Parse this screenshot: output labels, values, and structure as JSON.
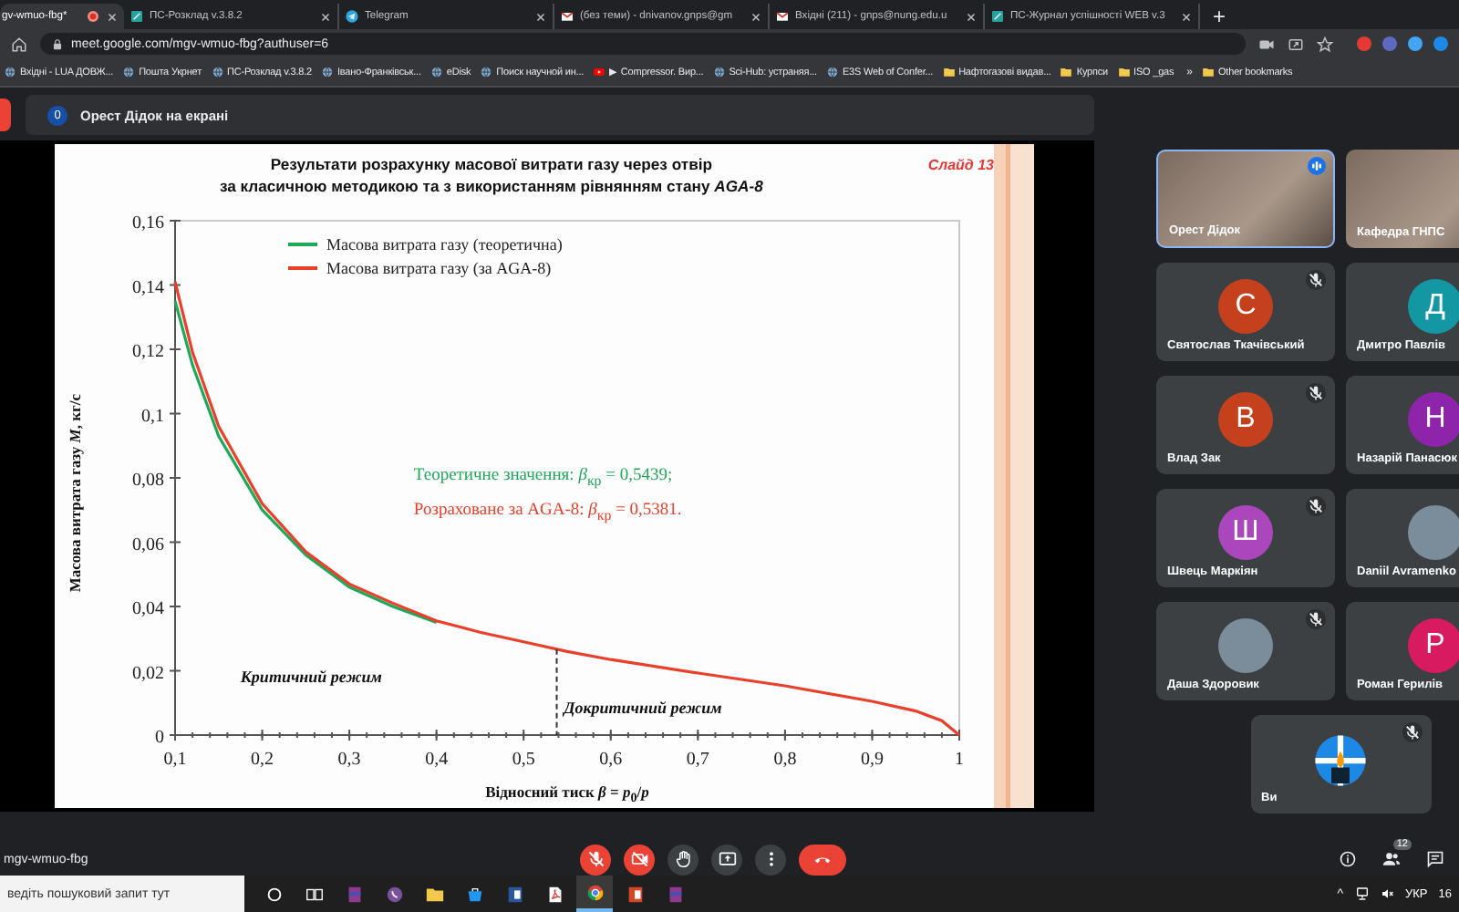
{
  "browser": {
    "tabs": [
      {
        "title": "gv-wmuo-fbg*",
        "kind": "meet",
        "selected": true
      },
      {
        "title": "ПС-Розклад v.3.8.2",
        "kind": "site",
        "selected": false
      },
      {
        "title": "Telegram",
        "kind": "telegram",
        "selected": false
      },
      {
        "title": "(без теми) - dnivanov.gnps@gm",
        "kind": "mail",
        "selected": false
      },
      {
        "title": "Вхідні (211) - gnps@nung.edu.u",
        "kind": "mail",
        "selected": false
      },
      {
        "title": "ПС-Журнал успішності WEB v.3",
        "kind": "site",
        "selected": false
      }
    ],
    "new_tab": "+",
    "url": "meet.google.com/mgv-wmuo-fbg?authuser=6",
    "bookmarks": [
      {
        "label": "Вхідні - LUA ДОВЖ...",
        "kind": "site"
      },
      {
        "label": "Пошта Укрнет",
        "kind": "site"
      },
      {
        "label": "ПС-Розклад v.3.8.2",
        "kind": "site"
      },
      {
        "label": "Івано-Франківськ...",
        "kind": "site"
      },
      {
        "label": "eDisk",
        "kind": "site"
      },
      {
        "label": "Поиск научной ин...",
        "kind": "site"
      },
      {
        "label": "▶ Compressor. Вир...",
        "kind": "video"
      },
      {
        "label": "Sci-Hub: устраняя...",
        "kind": "site"
      },
      {
        "label": "E3S Web of Confer...",
        "kind": "site"
      },
      {
        "label": "Нафтогазові видав...",
        "kind": "folder"
      },
      {
        "label": "Курпси",
        "kind": "folder"
      },
      {
        "label": "ISO _gas",
        "kind": "folder"
      }
    ],
    "more_bookmarks": "»",
    "other_bookmarks": "Other bookmarks"
  },
  "banner": {
    "count": "0",
    "text": "Орест Дідок на екрані"
  },
  "slide": {
    "title_lines": [
      "Результати розрахунку масової витрати газу через отвір",
      "за класичною методикою та з використанням рівнянням стану *AGA-8*"
    ],
    "slide_number": "Слайд 13",
    "chart_data": {
      "type": "line",
      "xlabel": "Відносний тиск *β* = *p*$_{0}$/*p*",
      "ylabel": "Масова витрата газу *M*, кг/с",
      "x": [
        0.1,
        0.12,
        0.15,
        0.2,
        0.25,
        0.3,
        0.35,
        0.4,
        0.45,
        0.5,
        0.55,
        0.6,
        0.7,
        0.8,
        0.9,
        0.95,
        0.98,
        1
      ],
      "series": [
        {
          "name": "Масова витрата газу (теоретична)",
          "color": "#1ea85a",
          "values": [
            0.135,
            0.115,
            0.093,
            0.07,
            0.056,
            0.046,
            0.04,
            0.035,
            null,
            null,
            null,
            null,
            null,
            null,
            null,
            null,
            null,
            null
          ]
        },
        {
          "name": "Масова витрата газу (за AGA-8)",
          "color": "#e8402a",
          "values": [
            0.141,
            0.119,
            0.096,
            0.072,
            0.057,
            0.047,
            0.041,
            0.0355,
            0.032,
            0.029,
            0.026,
            0.0235,
            0.0193,
            0.0153,
            0.0105,
            0.0075,
            0.0045,
            0
          ]
        }
      ],
      "xlim": [
        0.1,
        1
      ],
      "ylim": [
        0,
        0.16
      ],
      "xticks": [
        {
          "value": 0.1,
          "label": "0,1"
        },
        {
          "value": 0.2,
          "label": "0,2"
        },
        {
          "value": 0.3,
          "label": "0,3"
        },
        {
          "value": 0.4,
          "label": "0,4"
        },
        {
          "value": 0.5,
          "label": "0,5"
        },
        {
          "value": 0.6,
          "label": "0,6"
        },
        {
          "value": 0.7,
          "label": "0,7"
        },
        {
          "value": 0.8,
          "label": "0,8"
        },
        {
          "value": 0.9,
          "label": "0,9"
        },
        {
          "value": 1,
          "label": "1"
        }
      ],
      "yticks": [
        {
          "value": 0,
          "label": "0"
        },
        {
          "value": 0.02,
          "label": "0,02"
        },
        {
          "value": 0.04,
          "label": "0,04"
        },
        {
          "value": 0.06,
          "label": "0,06"
        },
        {
          "value": 0.08,
          "label": "0,08"
        },
        {
          "value": 0.1,
          "label": "0,1"
        },
        {
          "value": 0.12,
          "label": "0,12"
        },
        {
          "value": 0.14,
          "label": "0,14"
        },
        {
          "value": 0.16,
          "label": "0,16"
        }
      ],
      "legend": true,
      "annotations": [
        "Теоретичне значення:  *β*$_{кр}$ = 0,5439;",
        "Розраховане за AGA-8: *β*$_{кр}$ = 0,5381.",
        "Критичний режим",
        "Докритичний режим"
      ],
      "ref_lines": [
        {
          "axis": "x",
          "value": 0.538
        }
      ]
    }
  },
  "participants": [
    {
      "name": "Орест Дідок",
      "kind": "video",
      "speaking": true,
      "muted": false
    },
    {
      "name": "Кафедра ГНПС",
      "kind": "video",
      "speaking": false,
      "muted": false
    },
    {
      "name": "Святослав Ткачівський",
      "kind": "initial",
      "initial": "С",
      "color": "#c5401c",
      "speaking": false,
      "muted": true
    },
    {
      "name": "Дмитро Павлів",
      "kind": "initial",
      "initial": "Д",
      "color": "#1297a3",
      "speaking": false,
      "muted": false
    },
    {
      "name": "Влад Зак",
      "kind": "initial",
      "initial": "В",
      "color": "#c5401c",
      "speaking": false,
      "muted": true
    },
    {
      "name": "Назарій Панасюк",
      "kind": "initial",
      "initial": "Н",
      "color": "#8e24aa",
      "speaking": false,
      "muted": false
    },
    {
      "name": "Швець Маркіян",
      "kind": "initial",
      "initial": "Ш",
      "color": "#ab47bc",
      "speaking": false,
      "muted": true
    },
    {
      "name": "Daniil Avramenko",
      "kind": "photo",
      "speaking": false,
      "muted": false
    },
    {
      "name": "Даша Здоровик",
      "kind": "photo",
      "speaking": false,
      "muted": true
    },
    {
      "name": "Роман Герилів",
      "kind": "initial",
      "initial": "Р",
      "color": "#d81b60",
      "speaking": false,
      "muted": false
    },
    {
      "name": "Ви",
      "kind": "logo",
      "speaking": false,
      "muted": true
    }
  ],
  "controls": {
    "meeting_code": "mgv-wmuo-fbg",
    "buttons": [
      {
        "kind": "mic",
        "on": false
      },
      {
        "kind": "camera",
        "on": false
      },
      {
        "kind": "hand"
      },
      {
        "kind": "present"
      },
      {
        "kind": "more"
      },
      {
        "kind": "leave"
      }
    ],
    "people_count": "12"
  },
  "taskbar": {
    "search_placeholder": "ведіть пошуковий запит тут",
    "apps": [
      {
        "kind": "cortana",
        "selected": false
      },
      {
        "kind": "taskview",
        "selected": false
      },
      {
        "kind": "archive",
        "selected": false
      },
      {
        "kind": "viber",
        "selected": false
      },
      {
        "kind": "folder",
        "selected": false
      },
      {
        "kind": "store",
        "selected": false
      },
      {
        "kind": "word",
        "selected": false
      },
      {
        "kind": "pdf",
        "selected": false
      },
      {
        "kind": "chrome",
        "selected": true
      },
      {
        "kind": "slides",
        "selected": false
      },
      {
        "kind": "archive",
        "selected": false
      }
    ],
    "tray_arrow": "^",
    "language": "УКР",
    "clock": "16"
  }
}
